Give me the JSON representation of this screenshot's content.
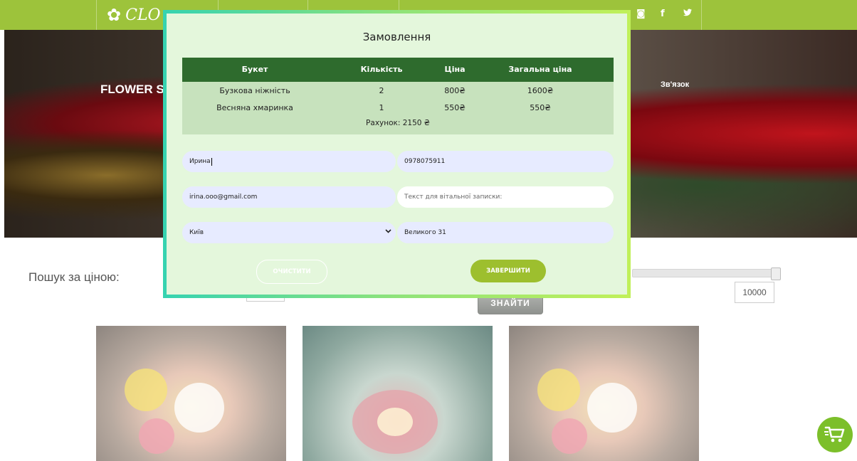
{
  "header": {
    "logo_text": "CLO",
    "social": [
      {
        "icon": "instagram-icon",
        "glyph": "◙"
      },
      {
        "icon": "facebook-icon",
        "glyph": "f"
      },
      {
        "icon": "twitter-icon",
        "glyph": "🐦"
      }
    ]
  },
  "hero": {
    "title": "FLOWER SI",
    "contact_link": "Зв'язок"
  },
  "search": {
    "label": "Пошук за ціною:",
    "max_value": "10000",
    "find_button": "ЗНАЙТИ"
  },
  "modal": {
    "title": "Замовлення",
    "table": {
      "headers": [
        "Букет",
        "Кількість",
        "Ціна",
        "Загальна ціна"
      ],
      "rows": [
        [
          "Бузкова ніжність",
          "2",
          "800₴",
          "1600₴"
        ],
        [
          "Весняна хмаринка",
          "1",
          "550₴",
          "550₴"
        ]
      ],
      "bill": "Рахунок: 2150 ₴"
    },
    "form": {
      "name": "Ирина",
      "phone": "0978075911",
      "email": "irina.ooo@gmail.com",
      "note_placeholder": "Текст для вітальної записки:",
      "city": "Київ",
      "address": "Великого 31"
    },
    "clear_button": "ОЧИСТИТИ",
    "finish_button": "ЗАВЕРШИТИ"
  },
  "colors": {
    "topbar": "#9dc33b",
    "modal_bg": "#e4f7dc",
    "table_header": "#2e6b2d",
    "table_body": "#c7e2bd",
    "finish_button": "#9dbf2e",
    "cart_button": "#7cbf2a"
  },
  "cart": {
    "icon": "shopping-cart-icon"
  }
}
